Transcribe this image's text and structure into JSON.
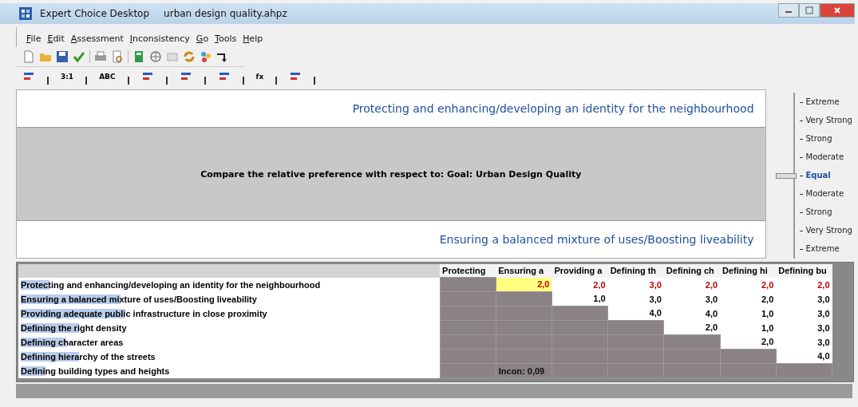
{
  "window": {
    "app": "Expert Choice Desktop",
    "file": "urban design quality.ahpz"
  },
  "menu": [
    {
      "key": "F",
      "rest": "ile"
    },
    {
      "key": "E",
      "rest": "dit"
    },
    {
      "key": "A",
      "rest": "ssessment"
    },
    {
      "key": "I",
      "rest": "nconsistency"
    },
    {
      "key": "G",
      "rest": "o"
    },
    {
      "key": "T",
      "rest": "ools"
    },
    {
      "key": "H",
      "rest": "elp"
    }
  ],
  "toolbar2": [
    {
      "kind": "icon"
    },
    {
      "kind": "text",
      "label": "3:1"
    },
    {
      "kind": "text",
      "label": "ABC"
    },
    {
      "kind": "icon"
    },
    {
      "kind": "icon"
    },
    {
      "kind": "icon"
    },
    {
      "kind": "text",
      "label": "fx"
    },
    {
      "kind": "icon"
    }
  ],
  "comparison": {
    "top": "Protecting and enhancing/developing an identity for the neighbourhood",
    "prompt": "Compare the relative preference with respect to: Goal: Urban Design Quality",
    "bottom": "Ensuring a balanced mixture of uses/Boosting liveability"
  },
  "scale": [
    {
      "label": "Extreme",
      "selected": false
    },
    {
      "label": "Very Strong",
      "selected": false
    },
    {
      "label": "Strong",
      "selected": false
    },
    {
      "label": "Moderate",
      "selected": false
    },
    {
      "label": "Equal",
      "selected": true
    },
    {
      "label": "Moderate",
      "selected": false
    },
    {
      "label": "Strong",
      "selected": false
    },
    {
      "label": "Very Strong",
      "selected": false
    },
    {
      "label": "Extreme",
      "selected": false
    }
  ],
  "matrix": {
    "columns": [
      "Protecting",
      "Ensuring a",
      "Providing a",
      "Defining th",
      "Defining ch",
      "Defining hi",
      "Defining bu"
    ],
    "rows": [
      {
        "label": "Protecting and enhancing/developing an identity for the neighbourhood",
        "level": 0.07,
        "cells": [
          {
            "kind": "blank"
          },
          {
            "kind": "value",
            "value": "2,0",
            "inverse": true,
            "selected": true
          },
          {
            "kind": "value",
            "value": "2,0",
            "inverse": true,
            "selected": false
          },
          {
            "kind": "value",
            "value": "3,0",
            "inverse": true,
            "selected": false
          },
          {
            "kind": "value",
            "value": "2,0",
            "inverse": true,
            "selected": false
          },
          {
            "kind": "value",
            "value": "2,0",
            "inverse": true,
            "selected": false
          },
          {
            "kind": "value",
            "value": "2,0",
            "inverse": true,
            "selected": false
          }
        ]
      },
      {
        "label": "Ensuring a balanced mixture of uses/Boosting liveability",
        "level": 0.24,
        "cells": [
          {
            "kind": "blank"
          },
          {
            "kind": "blank"
          },
          {
            "kind": "value",
            "value": "1,0",
            "inverse": false,
            "selected": false
          },
          {
            "kind": "value",
            "value": "3,0",
            "inverse": false,
            "selected": false
          },
          {
            "kind": "value",
            "value": "3,0",
            "inverse": false,
            "selected": false
          },
          {
            "kind": "value",
            "value": "2,0",
            "inverse": false,
            "selected": false
          },
          {
            "kind": "value",
            "value": "3,0",
            "inverse": false,
            "selected": false
          }
        ]
      },
      {
        "label": "Providing adequate public infrastructure in close proximity",
        "level": 0.25,
        "cells": [
          {
            "kind": "blank"
          },
          {
            "kind": "blank"
          },
          {
            "kind": "blank"
          },
          {
            "kind": "value",
            "value": "4,0",
            "inverse": false,
            "selected": false
          },
          {
            "kind": "value",
            "value": "4,0",
            "inverse": false,
            "selected": false
          },
          {
            "kind": "value",
            "value": "1,0",
            "inverse": false,
            "selected": false
          },
          {
            "kind": "value",
            "value": "3,0",
            "inverse": false,
            "selected": false
          }
        ]
      },
      {
        "label": "Defining the right density",
        "level": 0.14,
        "cells": [
          {
            "kind": "blank"
          },
          {
            "kind": "blank"
          },
          {
            "kind": "blank"
          },
          {
            "kind": "blank"
          },
          {
            "kind": "value",
            "value": "2,0",
            "inverse": false,
            "selected": false
          },
          {
            "kind": "value",
            "value": "1,0",
            "inverse": false,
            "selected": false
          },
          {
            "kind": "value",
            "value": "3,0",
            "inverse": false,
            "selected": false
          }
        ]
      },
      {
        "label": "Defining character areas",
        "level": 0.11,
        "cells": [
          {
            "kind": "blank"
          },
          {
            "kind": "blank"
          },
          {
            "kind": "blank"
          },
          {
            "kind": "blank"
          },
          {
            "kind": "blank"
          },
          {
            "kind": "value",
            "value": "2,0",
            "inverse": false,
            "selected": false
          },
          {
            "kind": "value",
            "value": "3,0",
            "inverse": false,
            "selected": false
          }
        ]
      },
      {
        "label": "Defining hierarchy of the streets",
        "level": 0.14,
        "cells": [
          {
            "kind": "blank"
          },
          {
            "kind": "blank"
          },
          {
            "kind": "blank"
          },
          {
            "kind": "blank"
          },
          {
            "kind": "blank"
          },
          {
            "kind": "blank"
          },
          {
            "kind": "value",
            "value": "4,0",
            "inverse": false,
            "selected": false
          }
        ]
      },
      {
        "label": "Defining building types and heights",
        "level": 0.06,
        "cells": [
          {
            "kind": "blank"
          },
          {
            "kind": "note",
            "value": "Incon: 0,09"
          },
          {
            "kind": "blank"
          },
          {
            "kind": "blank"
          },
          {
            "kind": "blank"
          },
          {
            "kind": "blank"
          },
          {
            "kind": "blank"
          }
        ]
      }
    ]
  }
}
